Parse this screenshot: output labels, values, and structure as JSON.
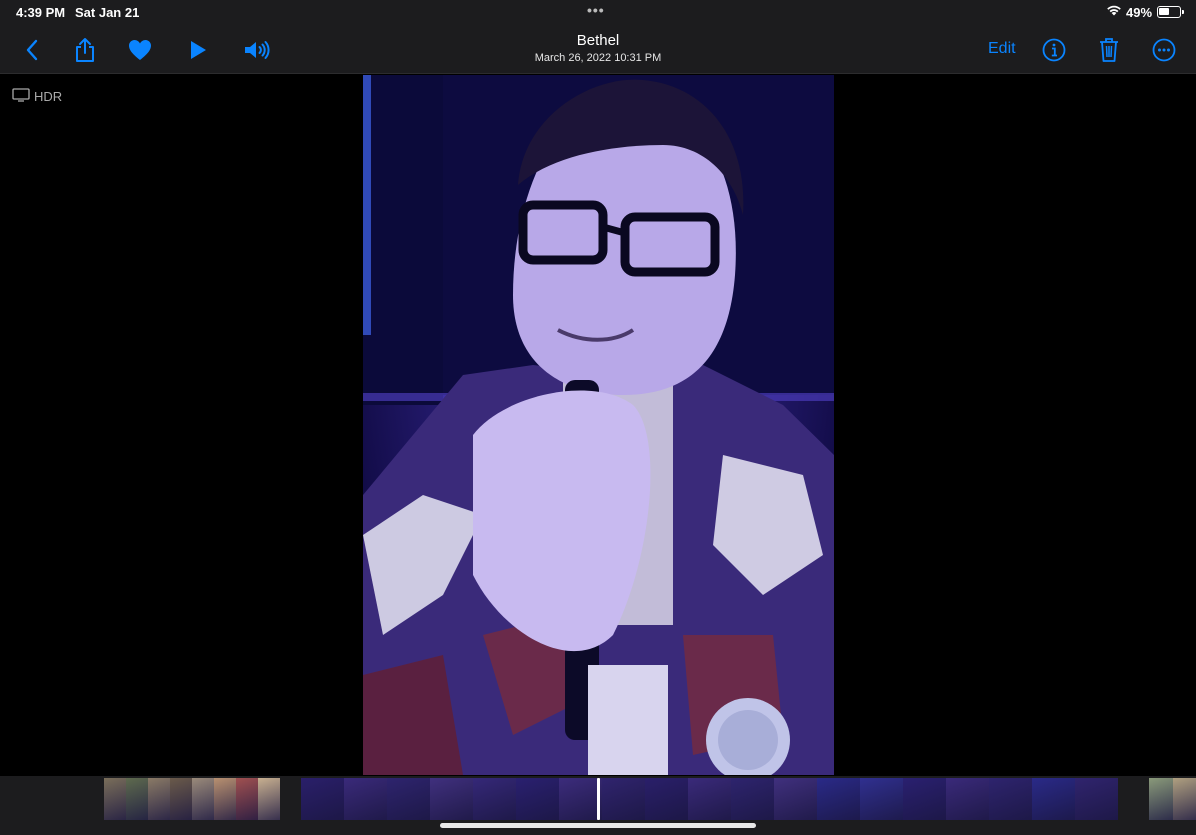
{
  "status_bar": {
    "time": "4:39 PM",
    "date": "Sat Jan 21",
    "battery_percent": "49%",
    "battery_level": 0.49,
    "wifi_icon": "wifi-icon",
    "multitask_dots": "•••"
  },
  "toolbar": {
    "title": "Bethel",
    "subtitle": "March 26, 2022  10:31 PM",
    "edit_label": "Edit",
    "accent_color": "#0a84ff",
    "icons": [
      "back-chevron-icon",
      "share-icon",
      "favorite-heart-icon",
      "play-icon",
      "speaker-icon",
      "info-icon",
      "trash-icon",
      "more-ellipsis-icon"
    ]
  },
  "badge": {
    "hdr_label": "HDR",
    "icon": "display-icon"
  },
  "filmstrip": {
    "thumbnail_groups": [
      {
        "name": "earlier-photos",
        "count": 8,
        "colors": [
          "#7a6e5a",
          "#5e6a4e",
          "#8a7a66",
          "#6a5a4a",
          "#9a8a7a",
          "#b89070",
          "#a05050",
          "#c8b090"
        ]
      },
      {
        "name": "video-frames",
        "count": 19,
        "colors": [
          "#2a1f6a",
          "#3a2a7a",
          "#2e246e",
          "#40307e",
          "#352878",
          "#2a2070",
          "#3c2c7c",
          "#30246e",
          "#2a1f6a",
          "#3a2a7a",
          "#2e246e",
          "#40307e",
          "#2a2a88",
          "#303090",
          "#2a2070",
          "#3a2a7a",
          "#2e246e",
          "#2a2a88",
          "#30246e"
        ]
      },
      {
        "name": "later-photos",
        "count": 2,
        "colors": [
          "#8a9a7a",
          "#b0a080"
        ]
      }
    ]
  }
}
